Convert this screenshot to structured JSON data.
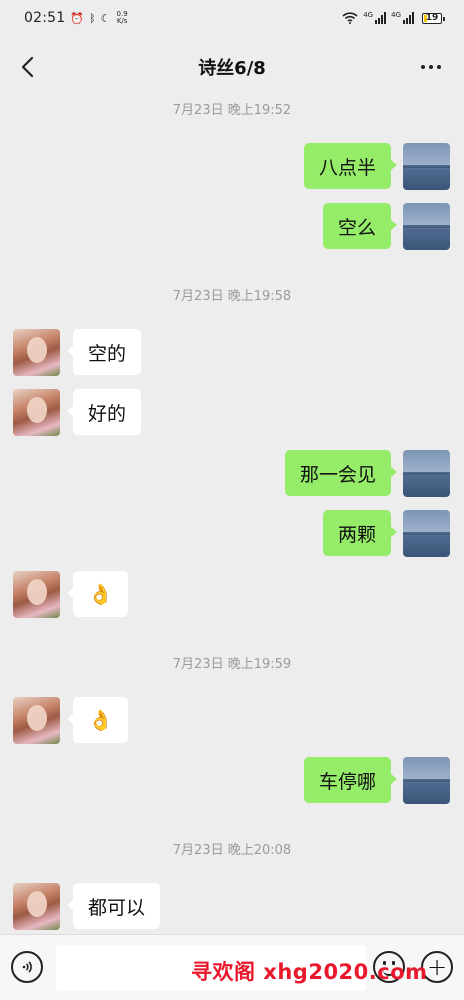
{
  "status_bar": {
    "time": "02:51",
    "net_speed_value": "0.9",
    "net_speed_unit": "K/s",
    "sim1_label": "4G",
    "sim2_label": "4G",
    "battery_level": "19",
    "icons": [
      "alarm-icon",
      "bluetooth-icon",
      "moon-icon",
      "wifi-icon",
      "signal-icon",
      "battery-icon"
    ]
  },
  "header": {
    "title": "诗丝6/8",
    "back_icon": "chevron-left-icon",
    "more_icon": "more-dots-icon"
  },
  "chat": {
    "timestamps": [
      "7月23日 晚上19:52",
      "7月23日 晚上19:58",
      "7月23日 晚上19:59",
      "7月23日 晚上20:08"
    ],
    "messages": [
      {
        "side": "right",
        "text": "八点半"
      },
      {
        "side": "right",
        "text": "空么"
      },
      {
        "side": "left",
        "text": "空的"
      },
      {
        "side": "left",
        "text": "好的"
      },
      {
        "side": "right",
        "text": "那一会见"
      },
      {
        "side": "right",
        "text": "两颗"
      },
      {
        "side": "left",
        "text": "👌"
      },
      {
        "side": "left",
        "text": "👌"
      },
      {
        "side": "right",
        "text": "车停哪"
      },
      {
        "side": "left",
        "text": "都可以"
      }
    ]
  },
  "input_bar": {
    "text_value": "",
    "voice_icon": "voice-icon",
    "emoji_icon": "emoji-icon",
    "plus_icon": "plus-icon"
  },
  "watermark": "寻欢阁 xhg2020.com",
  "colors": {
    "background": "#ededed",
    "sent_bubble": "#95ec69",
    "received_bubble": "#ffffff",
    "timestamp_text": "#9b9b9b",
    "watermark": "#e8192c"
  }
}
